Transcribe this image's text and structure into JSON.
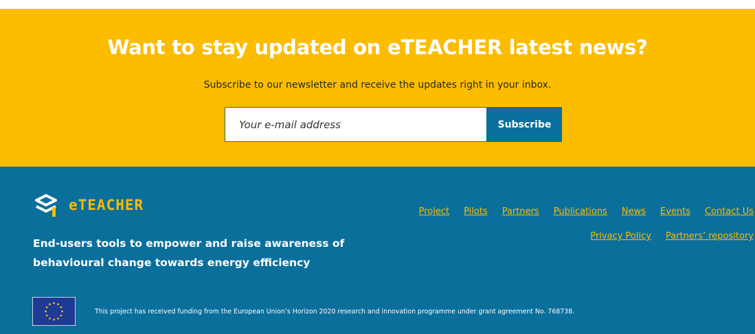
{
  "newsletter": {
    "heading": "Want to stay updated on eTEACHER latest news?",
    "subtext": "Subscribe to our newsletter and receive the updates right in your inbox.",
    "email_placeholder": "Your e-mail address",
    "email_value": "",
    "subscribe_label": "Subscribe"
  },
  "footer": {
    "logo_text": "eTEACHER",
    "tagline": "End-users tools to empower and raise awareness of behavioural change towards energy efficiency",
    "nav_row1": [
      "Project",
      "Pilots",
      "Partners",
      "Publications",
      "News",
      "Events",
      "Contact Us"
    ],
    "nav_row2": [
      "Privacy Policy",
      "Partners’ repository"
    ],
    "funding_text": "This project has received funding from the European Union’s Horizon 2020 research and innovation programme under grant agreement No. 768738."
  },
  "colors": {
    "newsletter_bg": "#fcbc00",
    "footer_bg": "#0b6f9c",
    "button_bg": "#0a6f9c",
    "link": "#fcbc00",
    "eu_blue": "#1f3a93",
    "eu_star": "#ffd400"
  },
  "icons": [
    "eteacher-logo-icon",
    "eu-flag-icon"
  ]
}
